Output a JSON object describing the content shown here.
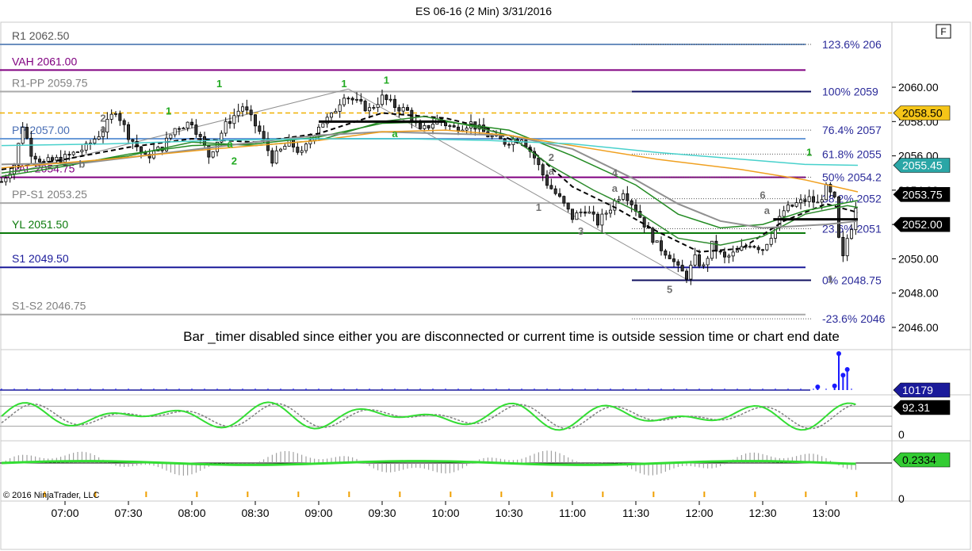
{
  "chart_data": {
    "type": "candlestick",
    "title": "ES 06-16 (2 Min)  3/31/2016",
    "f_button": "F",
    "copyright": "© 2016 NinjaTrader, LLC",
    "notice": "Bar _timer disabled since either you are disconnected or current time is outside session time or chart end date",
    "price_axis": {
      "ylim": [
        2044.75,
        2063.7
      ],
      "ticks": [
        2060.0,
        2058.0,
        2056.0,
        2054.0,
        2052.0,
        2050.0,
        2048.0,
        2046.0
      ]
    },
    "tick_labels": [
      "2060.00",
      "2058.00",
      "2056.00",
      "2054.00",
      "2052.00",
      "2050.00",
      "2048.00",
      "2046.00"
    ],
    "time_axis": {
      "labels": [
        "07:00",
        "07:30",
        "08:00",
        "08:30",
        "09:00",
        "09:30",
        "10:00",
        "10:30",
        "11:00",
        "11:30",
        "12:00",
        "12:30",
        "13:00"
      ],
      "start_minutes": 390,
      "end_minutes": 795,
      "visible_start": 390,
      "visible_end": 810,
      "bar_minutes": 2
    },
    "levels": [
      {
        "label": "R1 2062.50",
        "price": 2062.5,
        "color": "#6b8fbf",
        "text_color": "#555555"
      },
      {
        "label": "VAH 2061.00",
        "price": 2061.0,
        "color": "#800080",
        "text_color": "#800080"
      },
      {
        "label": "R1-PP 2059.75",
        "price": 2059.75,
        "color": "#a9a9a9",
        "text_color": "#808080"
      },
      {
        "label": "PP 2057.00",
        "price": 2057.0,
        "color": "#6b9bd8",
        "text_color": "#4a6fb5"
      },
      {
        "label": "VAL 2054.75",
        "price": 2054.75,
        "color": "#800080",
        "text_color": "#800080"
      },
      {
        "label": "PP-S1 2053.25",
        "price": 2053.25,
        "color": "#a9a9a9",
        "text_color": "#808080"
      },
      {
        "label": "YL 2051.50",
        "price": 2051.5,
        "color": "#0b7a0b",
        "text_color": "#0b7a0b"
      },
      {
        "label": "S1 2049.50",
        "price": 2049.5,
        "color": "#1a1a9a",
        "text_color": "#1a1a9a"
      },
      {
        "label": "S1-S2 2046.75",
        "price": 2046.75,
        "color": "#a9a9a9",
        "text_color": "#808080"
      }
    ],
    "dashed_level": {
      "price": 2058.5,
      "color": "#f0b000"
    },
    "fib_levels": [
      {
        "label": "123.6%  206",
        "price": 2062.5
      },
      {
        "label": "100%  2059",
        "price": 2059.75
      },
      {
        "label": "76.4%  2057",
        "price": 2057.5
      },
      {
        "label": "61.8%  2055",
        "price": 2056.1
      },
      {
        "label": "50%  2054.2",
        "price": 2054.75
      },
      {
        "label": "38.2%  2052",
        "price": 2053.5
      },
      {
        "label": "23.6%  2051",
        "price": 2051.75
      },
      {
        "label": "0%  2048.75",
        "price": 2048.75
      },
      {
        "label": "-23.6%  2046",
        "price": 2046.5
      }
    ],
    "price_tags": [
      {
        "label": "2058.50",
        "price": 2058.5,
        "bg": "#f5c518",
        "fg": "#000000"
      },
      {
        "label": "2055.45",
        "price": 2055.45,
        "bg": "#2aa6a6",
        "fg": "#ffffff"
      },
      {
        "label": "2053.75",
        "price": 2053.75,
        "bg": "#000000",
        "fg": "#ffffff"
      },
      {
        "label": "2052.00",
        "price": 2052.0,
        "bg": "#000000",
        "fg": "#ffffff"
      }
    ],
    "closes_anchor": [
      [
        390,
        2054.5
      ],
      [
        396,
        2055.5
      ],
      [
        400,
        2057.8
      ],
      [
        404,
        2056.2
      ],
      [
        410,
        2055.6
      ],
      [
        420,
        2055.9
      ],
      [
        430,
        2056.5
      ],
      [
        438,
        2057.5
      ],
      [
        444,
        2058.7
      ],
      [
        450,
        2057.2
      ],
      [
        458,
        2055.9
      ],
      [
        466,
        2056.5
      ],
      [
        472,
        2057.6
      ],
      [
        480,
        2058.0
      ],
      [
        488,
        2056.0
      ],
      [
        496,
        2057.8
      ],
      [
        504,
        2058.9
      ],
      [
        512,
        2057.4
      ],
      [
        518,
        2055.8
      ],
      [
        526,
        2056.8
      ],
      [
        532,
        2056.1
      ],
      [
        540,
        2057.8
      ],
      [
        546,
        2058.3
      ],
      [
        552,
        2059.6
      ],
      [
        558,
        2059.1
      ],
      [
        564,
        2058.7
      ],
      [
        570,
        2059.4
      ],
      [
        576,
        2058.9
      ],
      [
        582,
        2058.6
      ],
      [
        588,
        2057.4
      ],
      [
        596,
        2058.1
      ],
      [
        604,
        2057.6
      ],
      [
        612,
        2057.9
      ],
      [
        620,
        2057.2
      ],
      [
        628,
        2056.8
      ],
      [
        636,
        2057.1
      ],
      [
        642,
        2055.9
      ],
      [
        648,
        2054.4
      ],
      [
        654,
        2053.5
      ],
      [
        660,
        2052.4
      ],
      [
        666,
        2052.9
      ],
      [
        672,
        2052.1
      ],
      [
        678,
        2053.0
      ],
      [
        684,
        2054.0
      ],
      [
        690,
        2052.9
      ],
      [
        696,
        2051.6
      ],
      [
        700,
        2050.8
      ],
      [
        706,
        2050.2
      ],
      [
        710,
        2049.4
      ],
      [
        714,
        2049.0
      ],
      [
        718,
        2050.0
      ],
      [
        722,
        2049.5
      ],
      [
        726,
        2050.8
      ],
      [
        732,
        2050.0
      ],
      [
        738,
        2050.4
      ],
      [
        744,
        2050.9
      ],
      [
        750,
        2050.6
      ],
      [
        756,
        2051.8
      ],
      [
        760,
        2052.8
      ],
      [
        766,
        2053.2
      ],
      [
        772,
        2053.5
      ],
      [
        776,
        2053.2
      ],
      [
        780,
        2054.1
      ],
      [
        784,
        2053.4
      ],
      [
        786,
        2051.1
      ],
      [
        788,
        2050.0
      ],
      [
        790,
        2051.2
      ],
      [
        792,
        2051.9
      ],
      [
        795,
        2053.75
      ]
    ],
    "hl_extremes": {
      "high": 2059.9,
      "high_time": 556,
      "low": 2048.8,
      "low_time": 714
    },
    "series": [
      {
        "name": "black-dashed",
        "color": "#000000",
        "dash": "6,4",
        "width": 2,
        "points": [
          [
            390,
            2055.2
          ],
          [
            420,
            2055.8
          ],
          [
            450,
            2056.5
          ],
          [
            480,
            2057.0
          ],
          [
            510,
            2056.8
          ],
          [
            540,
            2057.3
          ],
          [
            570,
            2058.5
          ],
          [
            600,
            2058.2
          ],
          [
            620,
            2057.6
          ],
          [
            640,
            2056.4
          ],
          [
            660,
            2054.2
          ],
          [
            680,
            2053.0
          ],
          [
            700,
            2051.6
          ],
          [
            720,
            2050.4
          ],
          [
            740,
            2050.6
          ],
          [
            760,
            2052.2
          ],
          [
            780,
            2053.2
          ],
          [
            795,
            2052.7
          ]
        ]
      },
      {
        "name": "green-fast",
        "color": "#2e8b2e",
        "dash": "",
        "width": 1.5,
        "points": [
          [
            390,
            2055.0
          ],
          [
            420,
            2055.5
          ],
          [
            450,
            2056.0
          ],
          [
            480,
            2056.8
          ],
          [
            510,
            2056.6
          ],
          [
            540,
            2056.9
          ],
          [
            570,
            2058.0
          ],
          [
            590,
            2058.3
          ],
          [
            610,
            2057.8
          ],
          [
            630,
            2057.2
          ],
          [
            650,
            2055.4
          ],
          [
            670,
            2054.0
          ],
          [
            690,
            2052.8
          ],
          [
            710,
            2051.2
          ],
          [
            730,
            2050.8
          ],
          [
            750,
            2051.3
          ],
          [
            770,
            2052.6
          ],
          [
            790,
            2053.1
          ],
          [
            795,
            2053.0
          ]
        ]
      },
      {
        "name": "green-slow",
        "color": "#228b22",
        "dash": "",
        "width": 1.5,
        "points": [
          [
            390,
            2054.8
          ],
          [
            420,
            2055.4
          ],
          [
            450,
            2056.1
          ],
          [
            480,
            2056.6
          ],
          [
            510,
            2056.7
          ],
          [
            540,
            2057.1
          ],
          [
            570,
            2057.9
          ],
          [
            600,
            2058.0
          ],
          [
            630,
            2057.5
          ],
          [
            660,
            2056.0
          ],
          [
            690,
            2054.3
          ],
          [
            710,
            2052.6
          ],
          [
            730,
            2051.8
          ],
          [
            750,
            2052.0
          ],
          [
            770,
            2052.8
          ],
          [
            795,
            2053.4
          ]
        ]
      },
      {
        "name": "grey-sma",
        "color": "#909090",
        "dash": "",
        "width": 2,
        "points": [
          [
            390,
            2055.5
          ],
          [
            430,
            2055.6
          ],
          [
            470,
            2056.2
          ],
          [
            510,
            2056.8
          ],
          [
            540,
            2057.2
          ],
          [
            570,
            2057.4
          ],
          [
            600,
            2057.3
          ],
          [
            630,
            2057.2
          ],
          [
            660,
            2056.4
          ],
          [
            690,
            2054.6
          ],
          [
            710,
            2053.2
          ],
          [
            730,
            2052.2
          ],
          [
            750,
            2051.8
          ],
          [
            780,
            2052.0
          ],
          [
            795,
            2052.2
          ]
        ]
      },
      {
        "name": "orange-ema",
        "color": "#f0a020",
        "dash": "",
        "width": 1.5,
        "points": [
          [
            390,
            2055.3
          ],
          [
            440,
            2055.8
          ],
          [
            490,
            2056.4
          ],
          [
            540,
            2056.9
          ],
          [
            570,
            2057.4
          ],
          [
            600,
            2057.5
          ],
          [
            630,
            2057.2
          ],
          [
            660,
            2056.6
          ],
          [
            700,
            2055.8
          ],
          [
            740,
            2055.2
          ],
          [
            770,
            2054.6
          ],
          [
            795,
            2053.9
          ]
        ]
      },
      {
        "name": "cyan-ema",
        "color": "#48d1cc",
        "dash": "",
        "width": 1.5,
        "points": [
          [
            390,
            2056.6
          ],
          [
            440,
            2056.7
          ],
          [
            490,
            2056.9
          ],
          [
            540,
            2057.0
          ],
          [
            580,
            2057.0
          ],
          [
            620,
            2056.9
          ],
          [
            660,
            2056.7
          ],
          [
            700,
            2056.2
          ],
          [
            740,
            2055.8
          ],
          [
            770,
            2055.5
          ],
          [
            795,
            2055.45
          ]
        ]
      },
      {
        "name": "black-flat",
        "color": "#000000",
        "dash": "",
        "width": 3,
        "points": [
          [
            540,
            2058.0
          ],
          [
            600,
            2058.0
          ]
        ]
      },
      {
        "name": "black-flat-2",
        "color": "#000000",
        "dash": "",
        "width": 3,
        "points": [
          [
            755,
            2052.3
          ],
          [
            795,
            2052.3
          ]
        ]
      }
    ],
    "wave_labels": [
      {
        "text": "2",
        "t": 438,
        "price": 2058.0,
        "color": "#707070"
      },
      {
        "text": "a",
        "t": 438,
        "price": 2057.4,
        "color": "#707070"
      },
      {
        "text": "b",
        "t": 428,
        "price": 2055.3,
        "color": "#707070"
      },
      {
        "text": "1",
        "t": 469,
        "price": 2058.4,
        "color": "#22aa22"
      },
      {
        "text": "1",
        "t": 493,
        "price": 2060.0,
        "color": "#22aa22"
      },
      {
        "text": "2",
        "t": 500,
        "price": 2055.5,
        "color": "#22aa22"
      },
      {
        "text": "a",
        "t": 498,
        "price": 2056.5,
        "color": "#22aa22"
      },
      {
        "text": "1",
        "t": 552,
        "price": 2060.0,
        "color": "#22aa22"
      },
      {
        "text": "1",
        "t": 572,
        "price": 2060.2,
        "color": "#22aa22"
      },
      {
        "text": "a",
        "t": 576,
        "price": 2057.1,
        "color": "#22aa22"
      },
      {
        "text": "2",
        "t": 650,
        "price": 2055.7,
        "color": "#707070"
      },
      {
        "text": "a",
        "t": 650,
        "price": 2054.9,
        "color": "#707070"
      },
      {
        "text": "1",
        "t": 644,
        "price": 2052.8,
        "color": "#707070"
      },
      {
        "text": "3",
        "t": 664,
        "price": 2051.4,
        "color": "#707070"
      },
      {
        "text": "4",
        "t": 680,
        "price": 2054.8,
        "color": "#707070"
      },
      {
        "text": "a",
        "t": 680,
        "price": 2053.9,
        "color": "#707070"
      },
      {
        "text": "5",
        "t": 706,
        "price": 2048.0,
        "color": "#707070"
      },
      {
        "text": "6",
        "t": 750,
        "price": 2053.5,
        "color": "#707070"
      },
      {
        "text": "a",
        "t": 752,
        "price": 2052.6,
        "color": "#707070"
      },
      {
        "text": "1",
        "t": 772,
        "price": 2056.0,
        "color": "#22aa22"
      },
      {
        "text": "1",
        "t": 782,
        "price": 2048.6,
        "color": "#707070"
      }
    ],
    "volume": {
      "label": "10179",
      "ymax": 12000,
      "spikes": [
        [
          776,
          1500
        ],
        [
          784,
          1800
        ],
        [
          786,
          12000
        ],
        [
          788,
          5200
        ],
        [
          790,
          7000
        ]
      ]
    },
    "stochastic": {
      "label": "92.31",
      "tick_label": "0",
      "ylim": [
        0,
        100
      ]
    },
    "histogram": {
      "label": "0.2334",
      "tick_label": "0",
      "ylim": [
        -1,
        1
      ]
    },
    "volume_stats_color": "#1a1aff"
  }
}
